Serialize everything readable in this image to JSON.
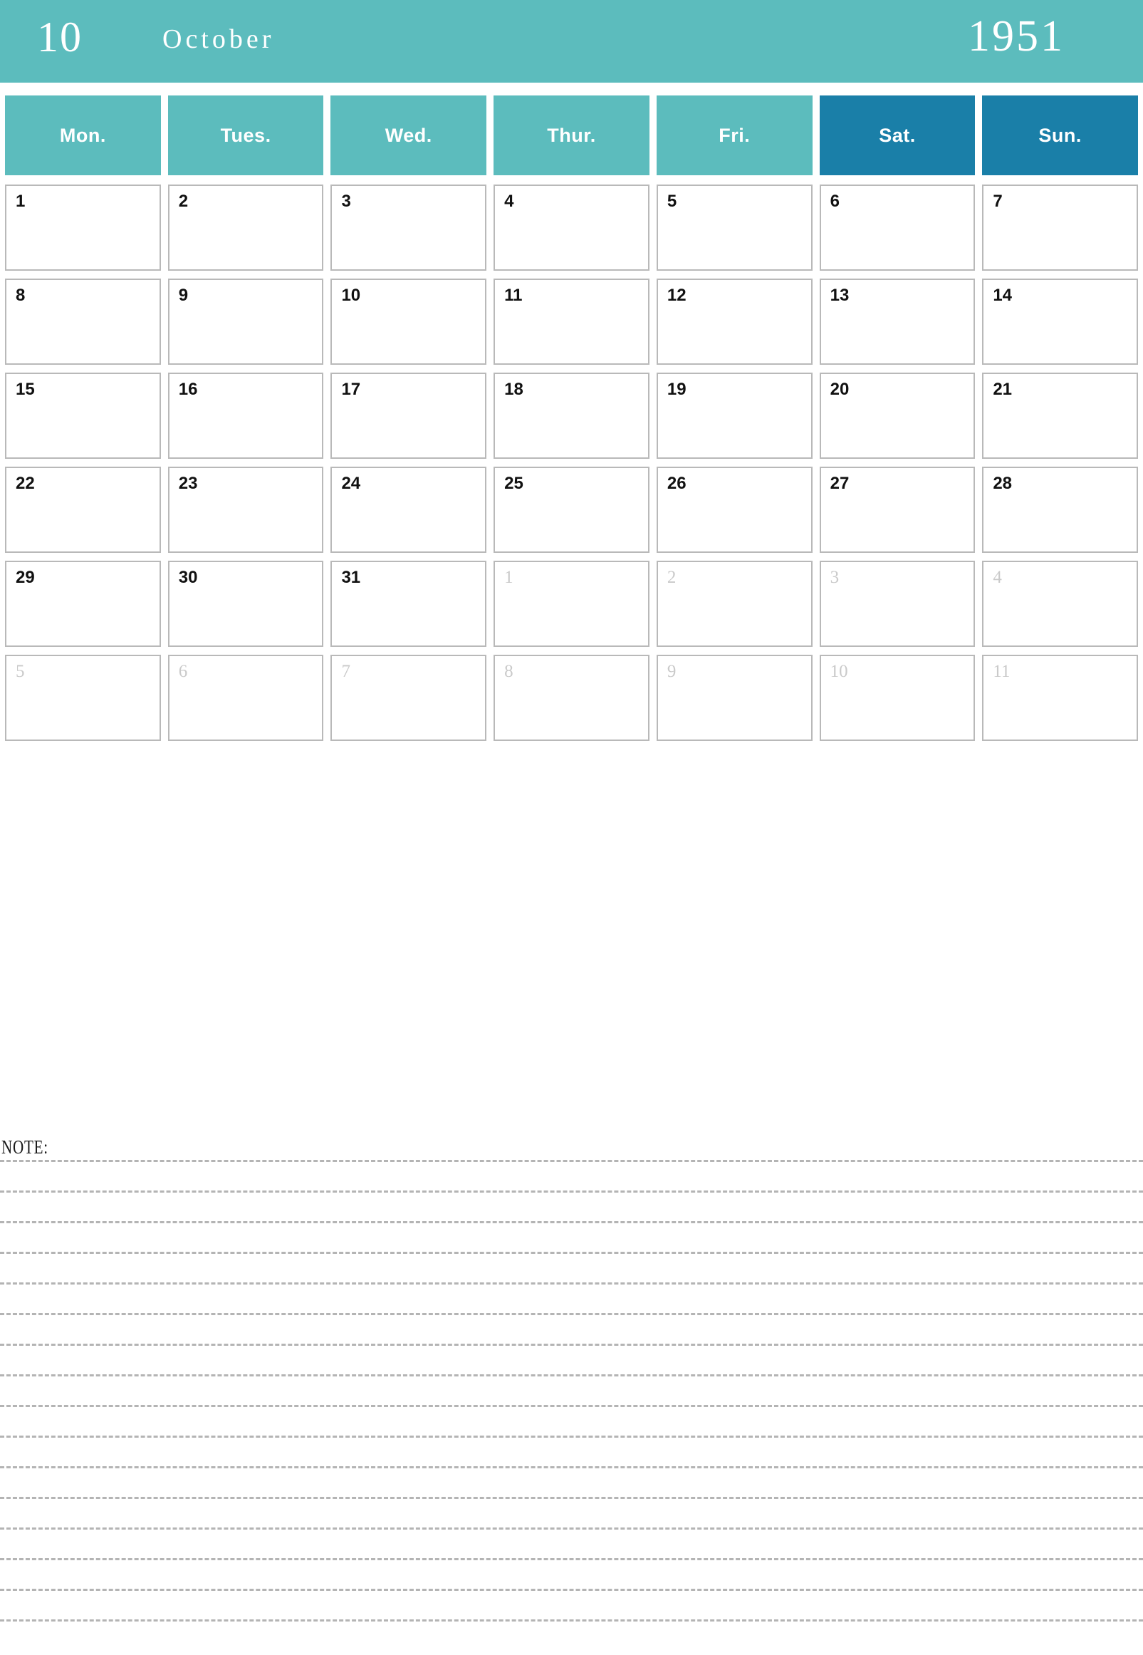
{
  "header": {
    "month_number": "10",
    "month_name": "October",
    "year": "1951",
    "bg_color": "#5cbcbd",
    "text_color": "#ffffff"
  },
  "weekdays": [
    {
      "label": "Mon.",
      "weekend": false
    },
    {
      "label": "Tues.",
      "weekend": false
    },
    {
      "label": "Wed.",
      "weekend": false
    },
    {
      "label": "Thur.",
      "weekend": false
    },
    {
      "label": "Fri.",
      "weekend": false
    },
    {
      "label": "Sat.",
      "weekend": true
    },
    {
      "label": "Sun.",
      "weekend": true
    }
  ],
  "colors": {
    "weekday_bg": "#5cbcbd",
    "weekend_bg": "#1a7fa8",
    "cell_border": "#b9b9b9",
    "date_text": "#111111",
    "outside_date_text": "#cacaca",
    "note_line": "#b4b4b4"
  },
  "weeks": [
    [
      {
        "day": "1",
        "outside": false
      },
      {
        "day": "2",
        "outside": false
      },
      {
        "day": "3",
        "outside": false
      },
      {
        "day": "4",
        "outside": false
      },
      {
        "day": "5",
        "outside": false
      },
      {
        "day": "6",
        "outside": false
      },
      {
        "day": "7",
        "outside": false
      }
    ],
    [
      {
        "day": "8",
        "outside": false
      },
      {
        "day": "9",
        "outside": false
      },
      {
        "day": "10",
        "outside": false
      },
      {
        "day": "11",
        "outside": false
      },
      {
        "day": "12",
        "outside": false
      },
      {
        "day": "13",
        "outside": false
      },
      {
        "day": "14",
        "outside": false
      }
    ],
    [
      {
        "day": "15",
        "outside": false
      },
      {
        "day": "16",
        "outside": false
      },
      {
        "day": "17",
        "outside": false
      },
      {
        "day": "18",
        "outside": false
      },
      {
        "day": "19",
        "outside": false
      },
      {
        "day": "20",
        "outside": false
      },
      {
        "day": "21",
        "outside": false
      }
    ],
    [
      {
        "day": "22",
        "outside": false
      },
      {
        "day": "23",
        "outside": false
      },
      {
        "day": "24",
        "outside": false
      },
      {
        "day": "25",
        "outside": false
      },
      {
        "day": "26",
        "outside": false
      },
      {
        "day": "27",
        "outside": false
      },
      {
        "day": "28",
        "outside": false
      }
    ],
    [
      {
        "day": "29",
        "outside": false
      },
      {
        "day": "30",
        "outside": false
      },
      {
        "day": "31",
        "outside": false
      },
      {
        "day": "1",
        "outside": true
      },
      {
        "day": "2",
        "outside": true
      },
      {
        "day": "3",
        "outside": true
      },
      {
        "day": "4",
        "outside": true
      }
    ],
    [
      {
        "day": "5",
        "outside": true
      },
      {
        "day": "6",
        "outside": true
      },
      {
        "day": "7",
        "outside": true
      },
      {
        "day": "8",
        "outside": true
      },
      {
        "day": "9",
        "outside": true
      },
      {
        "day": "10",
        "outside": true
      },
      {
        "day": "11",
        "outside": true
      }
    ]
  ],
  "note": {
    "title": "NOTE:",
    "line_count": 16
  }
}
